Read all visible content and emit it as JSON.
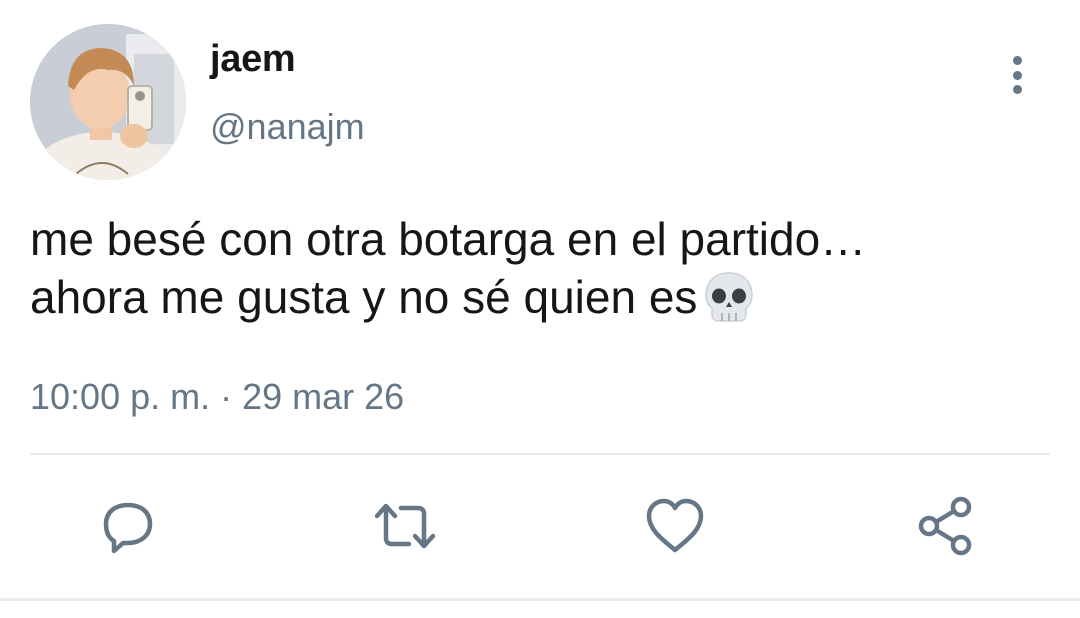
{
  "tweet": {
    "author": {
      "display_name": "jaem",
      "handle": "@nanajm",
      "avatar": "profile-photo"
    },
    "text_lines": [
      "me besé con otra botarga en el partido…",
      "ahora me gusta y no sé quien es"
    ],
    "emoji": "skull",
    "timestamp": "10:00 p. m. · 29 mar 26"
  },
  "actions": [
    {
      "name": "reply",
      "icon": "speech-bubble-icon"
    },
    {
      "name": "retweet",
      "icon": "retweet-arrows-icon"
    },
    {
      "name": "like",
      "icon": "heart-icon"
    },
    {
      "name": "share",
      "icon": "share-nodes-icon"
    }
  ],
  "menu": {
    "icon": "vertical-ellipsis-icon"
  },
  "colors": {
    "text_primary": "#14171a",
    "text_secondary": "#657786",
    "divider": "#e6ecf0"
  }
}
